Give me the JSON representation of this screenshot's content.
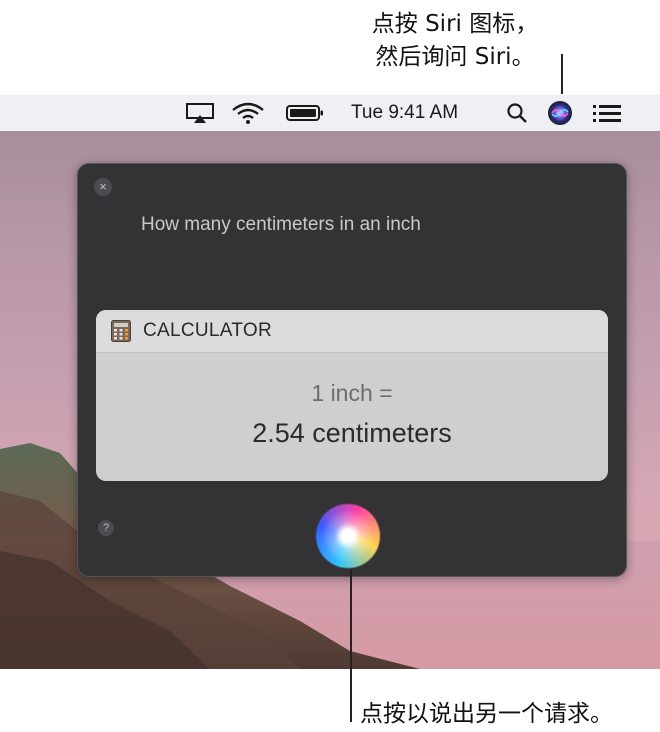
{
  "callouts": {
    "top_line1": "点按 Siri 图标，",
    "top_line2": "然后询问 Siri。",
    "bottom": "点按以说出另一个请求。"
  },
  "menubar": {
    "clock": "Tue 9:41 AM",
    "icons": [
      "airplay-icon",
      "wifi-icon",
      "battery-icon",
      "search-icon",
      "siri-icon",
      "control-list-icon"
    ]
  },
  "siri": {
    "close_label": "×",
    "query": "How many centimeters in an inch",
    "help_label": "?",
    "card": {
      "title": "CALCULATOR",
      "line1": "1 inch =",
      "line2": "2.54 centimeters"
    }
  }
}
